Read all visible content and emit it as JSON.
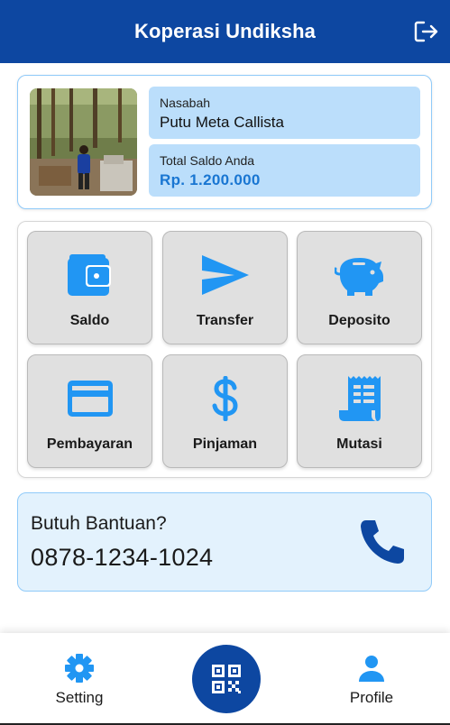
{
  "app_bar": {
    "title": "Koperasi Undiksha",
    "logout_icon": "logout-icon"
  },
  "profile": {
    "name_label": "Nasabah",
    "name": "Putu Meta Callista",
    "balance_label": "Total Saldo Anda",
    "balance": "Rp. 1.200.000"
  },
  "menu": {
    "items": [
      {
        "label": "Saldo",
        "icon": "wallet-icon"
      },
      {
        "label": "Transfer",
        "icon": "send-icon"
      },
      {
        "label": "Deposito",
        "icon": "piggy-bank-icon"
      },
      {
        "label": "Pembayaran",
        "icon": "credit-card-icon"
      },
      {
        "label": "Pinjaman",
        "icon": "dollar-icon"
      },
      {
        "label": "Mutasi",
        "icon": "receipt-icon"
      }
    ]
  },
  "help": {
    "title": "Butuh Bantuan?",
    "phone": "0878-1234-1024",
    "icon": "phone-icon"
  },
  "bottom_nav": {
    "setting_label": "Setting",
    "profile_label": "Profile",
    "qr_icon": "qr-code-icon"
  },
  "colors": {
    "primary": "#0d47a1",
    "accent": "#2196f3",
    "info_box": "#bbdefb",
    "help_bg": "#e3f2fd",
    "menu_button": "#e0e0e0"
  }
}
